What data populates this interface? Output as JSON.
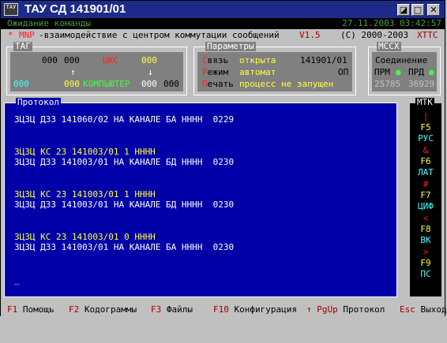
{
  "window": {
    "title": "ТАУ СД 141901/01",
    "app_icon_text": "ТАУ",
    "buttons": {
      "restore": "◪",
      "maximize": "□",
      "close": "✕"
    }
  },
  "status": {
    "message": "Ожидание команды",
    "datetime": "27.11.2003 03:42:57"
  },
  "info": {
    "star": "*",
    "mnp": "MNP",
    "text": "-взаимодействие с центром коммутации сообщений",
    "version": "V1.5",
    "copyright": "(C) 2000-2003",
    "brand": "XTTC"
  },
  "tag_panel": {
    "title": "ТАГ",
    "row1": {
      "a": "000",
      "b": "000",
      "label": "ЦКС",
      "c": "000"
    },
    "row2": {
      "arrow_up": "↑",
      "arrow_down": "↓"
    },
    "row3": {
      "a": "000",
      "b": "000",
      "label": "КОМПЬЮТЕР",
      "c": "000",
      "d": "000"
    }
  },
  "params_panel": {
    "title": "Параметры",
    "rows": [
      {
        "key_first": "С",
        "key_rest": "вязь",
        "value": "открыта",
        "extra": "141901/01"
      },
      {
        "key_first": "Р",
        "key_rest": "ежим",
        "value": "автомат",
        "extra": "ОП"
      },
      {
        "key_first": "П",
        "key_rest": "ечать",
        "value": "процесс не запущен",
        "extra": ""
      }
    ]
  },
  "mssx_panel": {
    "title": "МССХ",
    "label": "Соединение",
    "prm": "ПРМ",
    "prd": "ПРД",
    "dot": "●",
    "num1": "25785",
    "num2": "36929"
  },
  "protocol": {
    "title": "Протокол",
    "lines": [
      {
        "text": "ЗЦЗЦ ДЗ3 141060/02 НА КАНАЛЕ БА НННН  0229",
        "highlight": false
      },
      {
        "text": "",
        "highlight": false
      },
      {
        "text": "",
        "highlight": false
      },
      {
        "text": "ЗЦЗЦ КС 23 141003/01 1 НННН",
        "highlight": true
      },
      {
        "text": "ЗЦЗЦ ДЗ3 141003/01 НА КАНАЛЕ БД НННН  0230",
        "highlight": false
      },
      {
        "text": "",
        "highlight": false
      },
      {
        "text": "",
        "highlight": false
      },
      {
        "text": "ЗЦЗЦ КС 23 141003/01 1 НННН",
        "highlight": true
      },
      {
        "text": "ЗЦЗЦ ДЗ3 141003/01 НА КАНАЛЕ БД НННН  0230",
        "highlight": false
      },
      {
        "text": "",
        "highlight": false
      },
      {
        "text": "",
        "highlight": false
      },
      {
        "text": "ЗЦЗЦ КС 23 141003/01 0 НННН",
        "highlight": true
      },
      {
        "text": "ЗЦЗЦ ДЗ3 141003/01 НА КАНАЛЕ БА НННН  0230",
        "highlight": false
      },
      {
        "text": "",
        "highlight": false
      },
      {
        "text": "",
        "highlight": false
      },
      {
        "text": "_",
        "highlight": false
      }
    ]
  },
  "mtk": {
    "title": "МТК",
    "items": [
      {
        "sym": "|",
        "key": "F5",
        "label": "РУС"
      },
      {
        "sym": "&",
        "key": "F6",
        "label": "ЛАТ"
      },
      {
        "sym": "#",
        "key": "F7",
        "label": "ЦИФ"
      },
      {
        "sym": "<",
        "key": "F8",
        "label": "ВК"
      },
      {
        "sym": ">",
        "key": "F9",
        "label": "ПС"
      }
    ]
  },
  "fkeys": [
    {
      "key": "F1",
      "label": "Помощь"
    },
    {
      "key": "F2",
      "label": "Кодограммы"
    },
    {
      "key": "F3",
      "label": "Файлы"
    },
    {
      "key": "F10",
      "label": "Конфигурация"
    },
    {
      "key": "↑ PgUp",
      "label": "Протокол"
    },
    {
      "key": "Esc",
      "label": "Выход"
    }
  ],
  "colors": {
    "titlebar": "#1c2b8a",
    "protocol_bg": "#0000a8",
    "highlight_text": "#ffff40",
    "fkey_text": "#a00000"
  }
}
